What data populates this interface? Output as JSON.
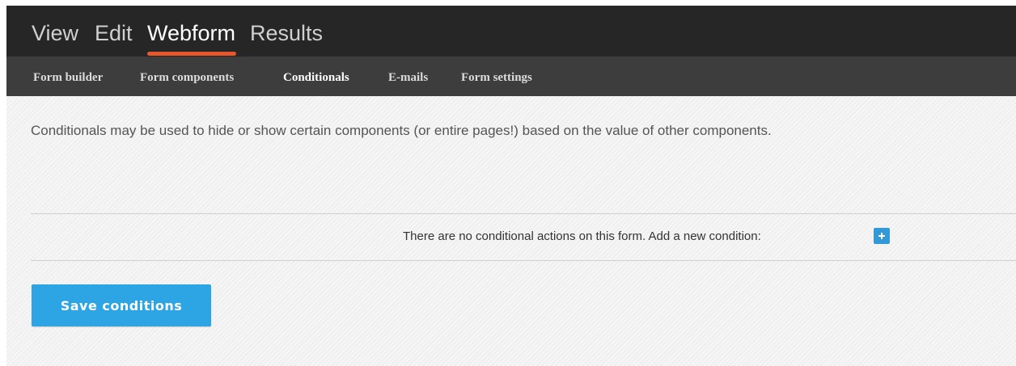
{
  "primary_tabs": [
    {
      "label": "View",
      "active": false
    },
    {
      "label": "Edit",
      "active": false
    },
    {
      "label": "Webform",
      "active": true
    },
    {
      "label": "Results",
      "active": false
    }
  ],
  "secondary_tabs": [
    {
      "label": "Form builder",
      "active": false
    },
    {
      "label": "Form components",
      "active": false
    },
    {
      "label": "Conditionals",
      "active": true
    },
    {
      "label": "E-mails",
      "active": false
    },
    {
      "label": "Form settings",
      "active": false
    }
  ],
  "description": "Conditionals may be used to hide or show certain components (or entire pages!) based on the value of other components.",
  "notice": "There are no conditional actions on this form. Add a new condition:",
  "add_condition_icon": "plus-icon",
  "save_button_label": "Save conditions",
  "colors": {
    "accent_underline": "#e8572b",
    "button_blue": "#2da4e4"
  }
}
